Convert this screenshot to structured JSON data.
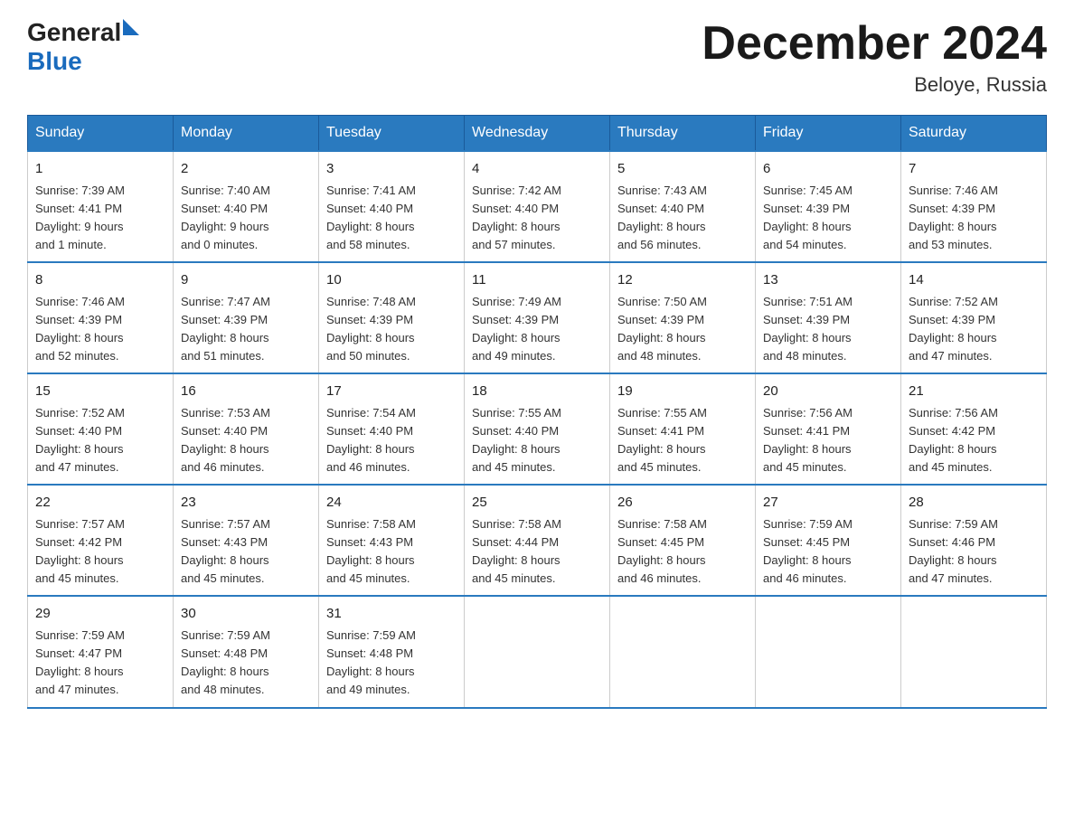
{
  "logo": {
    "general": "General",
    "blue": "Blue",
    "triangle_color": "#1a6bbd"
  },
  "header": {
    "month_title": "December 2024",
    "location": "Beloye, Russia"
  },
  "weekdays": [
    "Sunday",
    "Monday",
    "Tuesday",
    "Wednesday",
    "Thursday",
    "Friday",
    "Saturday"
  ],
  "weeks": [
    [
      {
        "day": "1",
        "sunrise": "7:39 AM",
        "sunset": "4:41 PM",
        "daylight": "9 hours and 1 minute."
      },
      {
        "day": "2",
        "sunrise": "7:40 AM",
        "sunset": "4:40 PM",
        "daylight": "9 hours and 0 minutes."
      },
      {
        "day": "3",
        "sunrise": "7:41 AM",
        "sunset": "4:40 PM",
        "daylight": "8 hours and 58 minutes."
      },
      {
        "day": "4",
        "sunrise": "7:42 AM",
        "sunset": "4:40 PM",
        "daylight": "8 hours and 57 minutes."
      },
      {
        "day": "5",
        "sunrise": "7:43 AM",
        "sunset": "4:40 PM",
        "daylight": "8 hours and 56 minutes."
      },
      {
        "day": "6",
        "sunrise": "7:45 AM",
        "sunset": "4:39 PM",
        "daylight": "8 hours and 54 minutes."
      },
      {
        "day": "7",
        "sunrise": "7:46 AM",
        "sunset": "4:39 PM",
        "daylight": "8 hours and 53 minutes."
      }
    ],
    [
      {
        "day": "8",
        "sunrise": "7:46 AM",
        "sunset": "4:39 PM",
        "daylight": "8 hours and 52 minutes."
      },
      {
        "day": "9",
        "sunrise": "7:47 AM",
        "sunset": "4:39 PM",
        "daylight": "8 hours and 51 minutes."
      },
      {
        "day": "10",
        "sunrise": "7:48 AM",
        "sunset": "4:39 PM",
        "daylight": "8 hours and 50 minutes."
      },
      {
        "day": "11",
        "sunrise": "7:49 AM",
        "sunset": "4:39 PM",
        "daylight": "8 hours and 49 minutes."
      },
      {
        "day": "12",
        "sunrise": "7:50 AM",
        "sunset": "4:39 PM",
        "daylight": "8 hours and 48 minutes."
      },
      {
        "day": "13",
        "sunrise": "7:51 AM",
        "sunset": "4:39 PM",
        "daylight": "8 hours and 48 minutes."
      },
      {
        "day": "14",
        "sunrise": "7:52 AM",
        "sunset": "4:39 PM",
        "daylight": "8 hours and 47 minutes."
      }
    ],
    [
      {
        "day": "15",
        "sunrise": "7:52 AM",
        "sunset": "4:40 PM",
        "daylight": "8 hours and 47 minutes."
      },
      {
        "day": "16",
        "sunrise": "7:53 AM",
        "sunset": "4:40 PM",
        "daylight": "8 hours and 46 minutes."
      },
      {
        "day": "17",
        "sunrise": "7:54 AM",
        "sunset": "4:40 PM",
        "daylight": "8 hours and 46 minutes."
      },
      {
        "day": "18",
        "sunrise": "7:55 AM",
        "sunset": "4:40 PM",
        "daylight": "8 hours and 45 minutes."
      },
      {
        "day": "19",
        "sunrise": "7:55 AM",
        "sunset": "4:41 PM",
        "daylight": "8 hours and 45 minutes."
      },
      {
        "day": "20",
        "sunrise": "7:56 AM",
        "sunset": "4:41 PM",
        "daylight": "8 hours and 45 minutes."
      },
      {
        "day": "21",
        "sunrise": "7:56 AM",
        "sunset": "4:42 PM",
        "daylight": "8 hours and 45 minutes."
      }
    ],
    [
      {
        "day": "22",
        "sunrise": "7:57 AM",
        "sunset": "4:42 PM",
        "daylight": "8 hours and 45 minutes."
      },
      {
        "day": "23",
        "sunrise": "7:57 AM",
        "sunset": "4:43 PM",
        "daylight": "8 hours and 45 minutes."
      },
      {
        "day": "24",
        "sunrise": "7:58 AM",
        "sunset": "4:43 PM",
        "daylight": "8 hours and 45 minutes."
      },
      {
        "day": "25",
        "sunrise": "7:58 AM",
        "sunset": "4:44 PM",
        "daylight": "8 hours and 45 minutes."
      },
      {
        "day": "26",
        "sunrise": "7:58 AM",
        "sunset": "4:45 PM",
        "daylight": "8 hours and 46 minutes."
      },
      {
        "day": "27",
        "sunrise": "7:59 AM",
        "sunset": "4:45 PM",
        "daylight": "8 hours and 46 minutes."
      },
      {
        "day": "28",
        "sunrise": "7:59 AM",
        "sunset": "4:46 PM",
        "daylight": "8 hours and 47 minutes."
      }
    ],
    [
      {
        "day": "29",
        "sunrise": "7:59 AM",
        "sunset": "4:47 PM",
        "daylight": "8 hours and 47 minutes."
      },
      {
        "day": "30",
        "sunrise": "7:59 AM",
        "sunset": "4:48 PM",
        "daylight": "8 hours and 48 minutes."
      },
      {
        "day": "31",
        "sunrise": "7:59 AM",
        "sunset": "4:48 PM",
        "daylight": "8 hours and 49 minutes."
      },
      null,
      null,
      null,
      null
    ]
  ],
  "labels": {
    "sunrise": "Sunrise:",
    "sunset": "Sunset:",
    "daylight": "Daylight:"
  }
}
